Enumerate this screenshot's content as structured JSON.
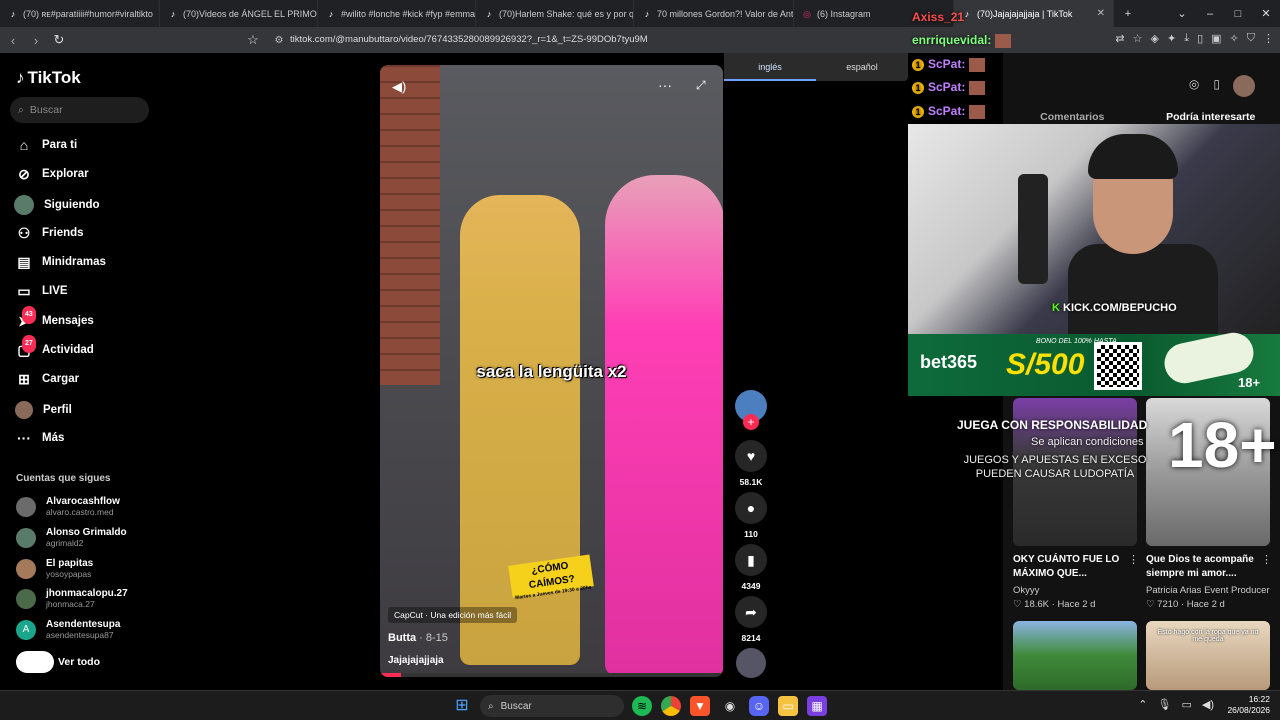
{
  "browser": {
    "tabs": [
      {
        "title": "(70) ʀᴇ#paratiiii#humor#viraltikto",
        "icon": "tiktok-icon"
      },
      {
        "title": "(70)Videos de ÁNGEL EL PRIMO",
        "icon": "tiktok-icon"
      },
      {
        "title": "#wilito #lonche #kick #fyp #emmac",
        "icon": "tiktok-icon"
      },
      {
        "title": "(70)Harlem Shake: qué es y por qué",
        "icon": "tiktok-icon"
      },
      {
        "title": "70 millones Gordon?! Valor de Anth",
        "icon": "tiktok-icon"
      },
      {
        "title": "(6) Instagram",
        "icon": "instagram-icon"
      },
      {
        "title": "(70)Jajajajajjaja | TikTok",
        "icon": "tiktok-icon",
        "active": true
      }
    ],
    "url": "tiktok.com/@manubuttaro/video/7674335280089926932?_r=1&_t=ZS-99DOb7tyu9M"
  },
  "translation": {
    "lang_from": "inglés",
    "lang_to": "español"
  },
  "sidebar": {
    "logo": "TikTok",
    "search_placeholder": "Buscar",
    "nav": [
      {
        "label": "Para ti",
        "icon": "home-icon"
      },
      {
        "label": "Explorar",
        "icon": "compass-icon"
      },
      {
        "label": "Siguiendo",
        "icon": "following-avatar-icon"
      },
      {
        "label": "Friends",
        "icon": "friends-icon"
      },
      {
        "label": "Minidramas",
        "icon": "film-icon"
      },
      {
        "label": "LIVE",
        "icon": "live-icon"
      },
      {
        "label": "Mensajes",
        "icon": "messages-icon",
        "badge": "43"
      },
      {
        "label": "Actividad",
        "icon": "activity-icon",
        "badge": "27"
      },
      {
        "label": "Cargar",
        "icon": "upload-icon"
      },
      {
        "label": "Perfil",
        "icon": "profile-icon"
      },
      {
        "label": "Más",
        "icon": "more-icon"
      }
    ],
    "following_heading": "Cuentas que sigues",
    "following": [
      {
        "name": "Alvarocashflow",
        "handle": "alvaro.castro.med"
      },
      {
        "name": "Alonso Grimaldo",
        "handle": "agrimald2"
      },
      {
        "name": "El papitas",
        "handle": "yosoypapas"
      },
      {
        "name": "jhonmacalopu.27",
        "handle": "jhonmaca.27"
      },
      {
        "name": "Asendentesupa",
        "handle": "asendentesupa87",
        "initial": "A"
      }
    ],
    "see_all": "Ver todo"
  },
  "video": {
    "caption": "saca la lengüita x2",
    "sticker_main": "¿CÓMO CAÍMOS?",
    "sticker_sub": "Martes a Jueves de 19:30 a 20hs",
    "capcut": "CapCut · Una edición más fácil",
    "author": "Butta",
    "date": " · 8-15",
    "description": "Jajajajajjaja",
    "progress": 0.06
  },
  "actions": {
    "likes": "58.1K",
    "comments": "110",
    "saves": "4349",
    "shares": "8214"
  },
  "right_panel": {
    "tabs": [
      "Comentarios",
      "Podría interesarte"
    ],
    "cards": [
      {
        "title": "OKY CUÁNTO FUE LO MÁXIMO QUE...",
        "author": "Okyyy",
        "likes": "18.6K",
        "time": "Hace 2 d"
      },
      {
        "title": "Que Dios te acompañe siempre mi amor....",
        "author": "Patricia Arias Event Producer",
        "likes": "7210",
        "time": "Hace 2 d"
      }
    ],
    "card3_text": "Esto hago con la ropa que ya no me queda"
  },
  "stream_overlay": {
    "kick": "KICK.COM/BEPUCHO",
    "chat": [
      {
        "name": "Axiss_21",
        "color": "#ff4d4d"
      },
      {
        "name": "enrriquevidal:",
        "color": "#7dff7d"
      },
      {
        "name": "ScPat:",
        "color": "#c080ff",
        "badge": "1"
      },
      {
        "name": "ScPat:",
        "color": "#c080ff",
        "badge": "1"
      },
      {
        "name": "ScPat:",
        "color": "#c080ff",
        "badge": "1"
      }
    ],
    "bet_logo": "bet365",
    "bet_promo": "BONO DEL 100% HASTA",
    "bet_amount": "S/500",
    "bet_age": "18+",
    "juega": "JUEGA CON RESPONSABILIDAD",
    "aplican": "Se aplican condiciones",
    "juegos": "JUEGOS Y APUESTAS EN EXCESO PUEDEN CAUSAR LUDOPATÍA",
    "big_age": "18+"
  },
  "taskbar": {
    "search": "Buscar",
    "time": "16:22",
    "date": "26/08/2026"
  },
  "colors": {
    "accent": "#fe2c55",
    "kick_green": "#53fc18",
    "bet_yellow": "#ffe100"
  }
}
